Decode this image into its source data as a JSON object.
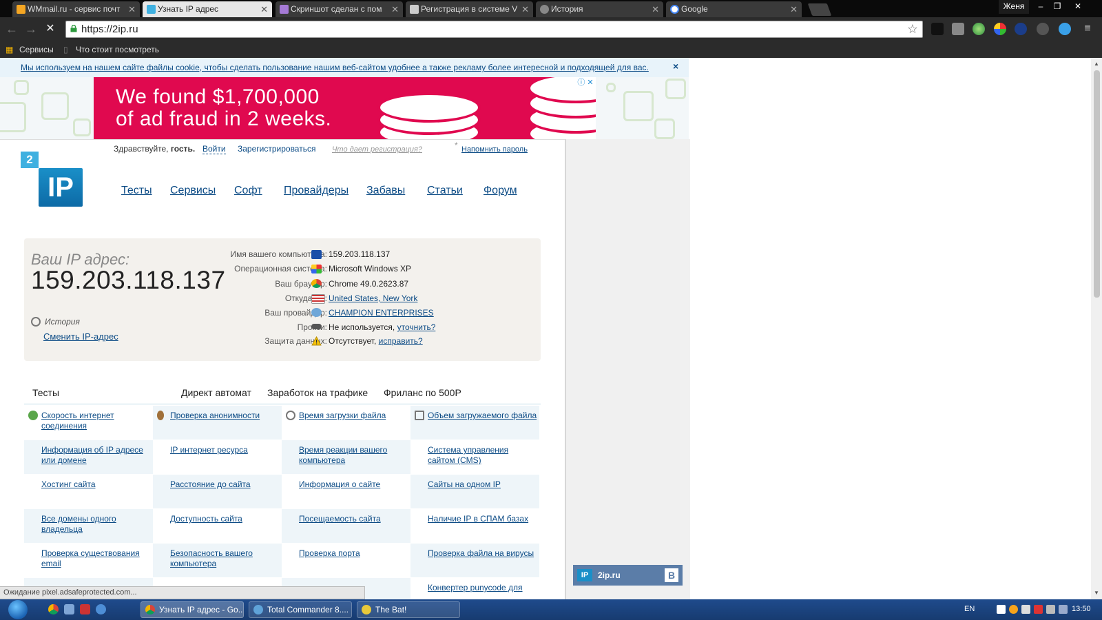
{
  "browser": {
    "tabs": [
      {
        "title": "WMmail.ru - сервис почт",
        "active": false
      },
      {
        "title": "Узнать IP адрес",
        "active": true
      },
      {
        "title": "Скриншот сделан с пом",
        "active": false
      },
      {
        "title": "Регистрация в системе V",
        "active": false
      },
      {
        "title": "История",
        "active": false
      },
      {
        "title": "Google",
        "active": false
      }
    ],
    "user": "Женя",
    "url": "https://2ip.ru",
    "bookmarks": {
      "apps": "Сервисы",
      "item": "Что стоит посмотреть"
    },
    "status": "Ожидание pixel.adsafeprotected.com..."
  },
  "page": {
    "cookie_notice": "Мы используем на нашем сайте файлы cookie, чтобы сделать пользование нашим веб-сайтом удобнее а также рекламу более интересной и подходящей для вас.",
    "cookie_close": "×",
    "ad": {
      "line1": "We found $1,700,000",
      "line2": "of ad fraud in 2 weeks.",
      "badge": "ⓘ ✕"
    },
    "logo": {
      "two": "2",
      "ip": "IP"
    },
    "header": {
      "greeting": "Здравствуйте,",
      "guest": "гость.",
      "login": "Войти",
      "register": "Зарегистрироваться",
      "why_register": "Что дает регистрация?",
      "asterisk": "*",
      "remind": "Напомнить пароль"
    },
    "nav": [
      "Тесты",
      "Сервисы",
      "Софт",
      "Провайдеры",
      "Забавы",
      "Статьи",
      "Форум"
    ],
    "ipinfo": {
      "label": "Ваш IP адрес:",
      "ip": "159.203.118.137",
      "history": "История",
      "change_ip": "Сменить IP-адрес",
      "rows": [
        {
          "label": "Имя вашего компьютера:",
          "value": "159.203.118.137"
        },
        {
          "label": "Операционная система:",
          "value": "Microsoft Windows XP"
        },
        {
          "label": "Ваш браузер:",
          "value": "Chrome 49.0.2623.87"
        },
        {
          "label": "Откуда вы:",
          "value": "United States, New York"
        },
        {
          "label": "Ваш провайдер:",
          "value": "CHAMPION ENTERPRISES"
        },
        {
          "label": "Прокси:",
          "value": "Не используется,",
          "link": "уточнить?"
        },
        {
          "label": "Защита данных:",
          "value": "Отсутствует,",
          "link": "исправить?"
        }
      ]
    },
    "tabs": [
      "Тесты",
      "Директ автомат",
      "Заработок на трафике",
      "Фриланс по 500Р"
    ],
    "links": [
      [
        "Скорость интернет соединения",
        "Проверка анонимности",
        "Время загрузки файла",
        "Объем загружаемого файла"
      ],
      [
        "Информация об IP адресе или домене",
        "IP интернет ресурса",
        "Время реакции вашего компьютера",
        "Система управления сайтом (CMS)"
      ],
      [
        "Хостинг сайта",
        "Расстояние до сайта",
        "Информация о сайте",
        "Сайты на одном IP"
      ],
      [
        "Все домены одного владельца",
        "Доступность сайта",
        "Посещаемость сайта",
        "Наличие IP в СПАМ базах"
      ],
      [
        "Проверка существования email",
        "Безопасность вашего компьютера",
        "Проверка порта",
        "Проверка файла на вирусы"
      ],
      [
        "",
        "ности",
        "",
        "Конвертер punycode для"
      ]
    ],
    "social": {
      "icon": "IP",
      "name": "2ip.ru",
      "vk": "В"
    }
  },
  "taskbar": {
    "items": [
      "Узнать IP адрес - Go...",
      "Total Commander 8....",
      "The Bat!"
    ],
    "lang": "EN",
    "time": "13:50"
  }
}
